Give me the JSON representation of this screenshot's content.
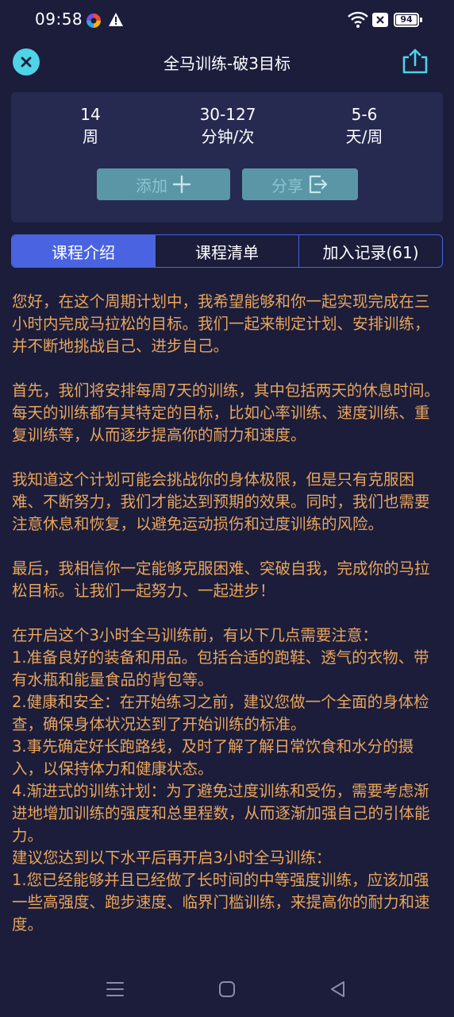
{
  "status": {
    "time": "09:58",
    "battery": "94"
  },
  "header": {
    "title": "全马训练-破3目标",
    "close_icon": "close-icon",
    "share_icon": "share-icon",
    "accent_color": "#4fd3e6"
  },
  "summary": {
    "stats": [
      {
        "value": "14",
        "unit": "周"
      },
      {
        "value": "30-127",
        "unit": "分钟/次"
      },
      {
        "value": "5-6",
        "unit": "天/周"
      }
    ],
    "add_label": "添加",
    "share_label": "分享"
  },
  "tabs": [
    {
      "label": "课程介绍",
      "active": true
    },
    {
      "label": "课程清单",
      "active": false
    },
    {
      "label": "加入记录(61)",
      "active": false
    }
  ],
  "content": {
    "p1": "您好，在这个周期计划中，我希望能够和你一起实现完成在三小时内完成马拉松的目标。我们一起来制定计划、安排训练，并不断地挑战自己、进步自己。",
    "p2": "首先，我们将安排每周7天的训练，其中包括两天的休息时间。每天的训练都有其特定的目标，比如心率训练、速度训练、重复训练等，从而逐步提高你的耐力和速度。",
    "p3": "我知道这个计划可能会挑战你的身体极限，但是只有克服困难、不断努力，我们才能达到预期的效果。同时，我们也需要注意休息和恢复，以避免运动损伤和过度训练的风险。",
    "p4": "最后，我相信你一定能够克服困难、突破自我，完成你的马拉松目标。让我们一起努力、一起进步！",
    "l1": "在开启这个3小时全马训练前，有以下几点需要注意：",
    "l2": "1.准备良好的装备和用品。包括合适的跑鞋、透气的衣物、带有水瓶和能量食品的背包等。",
    "l3": "2.健康和安全：在开始练习之前，建议您做一个全面的身体检查，确保身体状况达到了开始训练的标准。",
    "l4": "3.事先确定好长跑路线，及时了解了解日常饮食和水分的摄入，以保持体力和健康状态。",
    "l5": "4.渐进式的训练计划：为了避免过度训练和受伤，需要考虑渐进地增加训练的强度和总里程数，从而逐渐加强自己的引体能力。",
    "l6": "建议您达到以下水平后再开启3小时全马训练：",
    "l7": "1.您已经能够并且已经做了长时间的中等强度训练，应该加强一些高强度、跑步速度、临界门槛训练，来提高你的耐力和速度。"
  },
  "colors": {
    "background": "#1b1d3b",
    "card": "#262a50",
    "tab_active": "#4a63e0",
    "body_text": "#e9a55b",
    "button": "#5a96a6"
  }
}
